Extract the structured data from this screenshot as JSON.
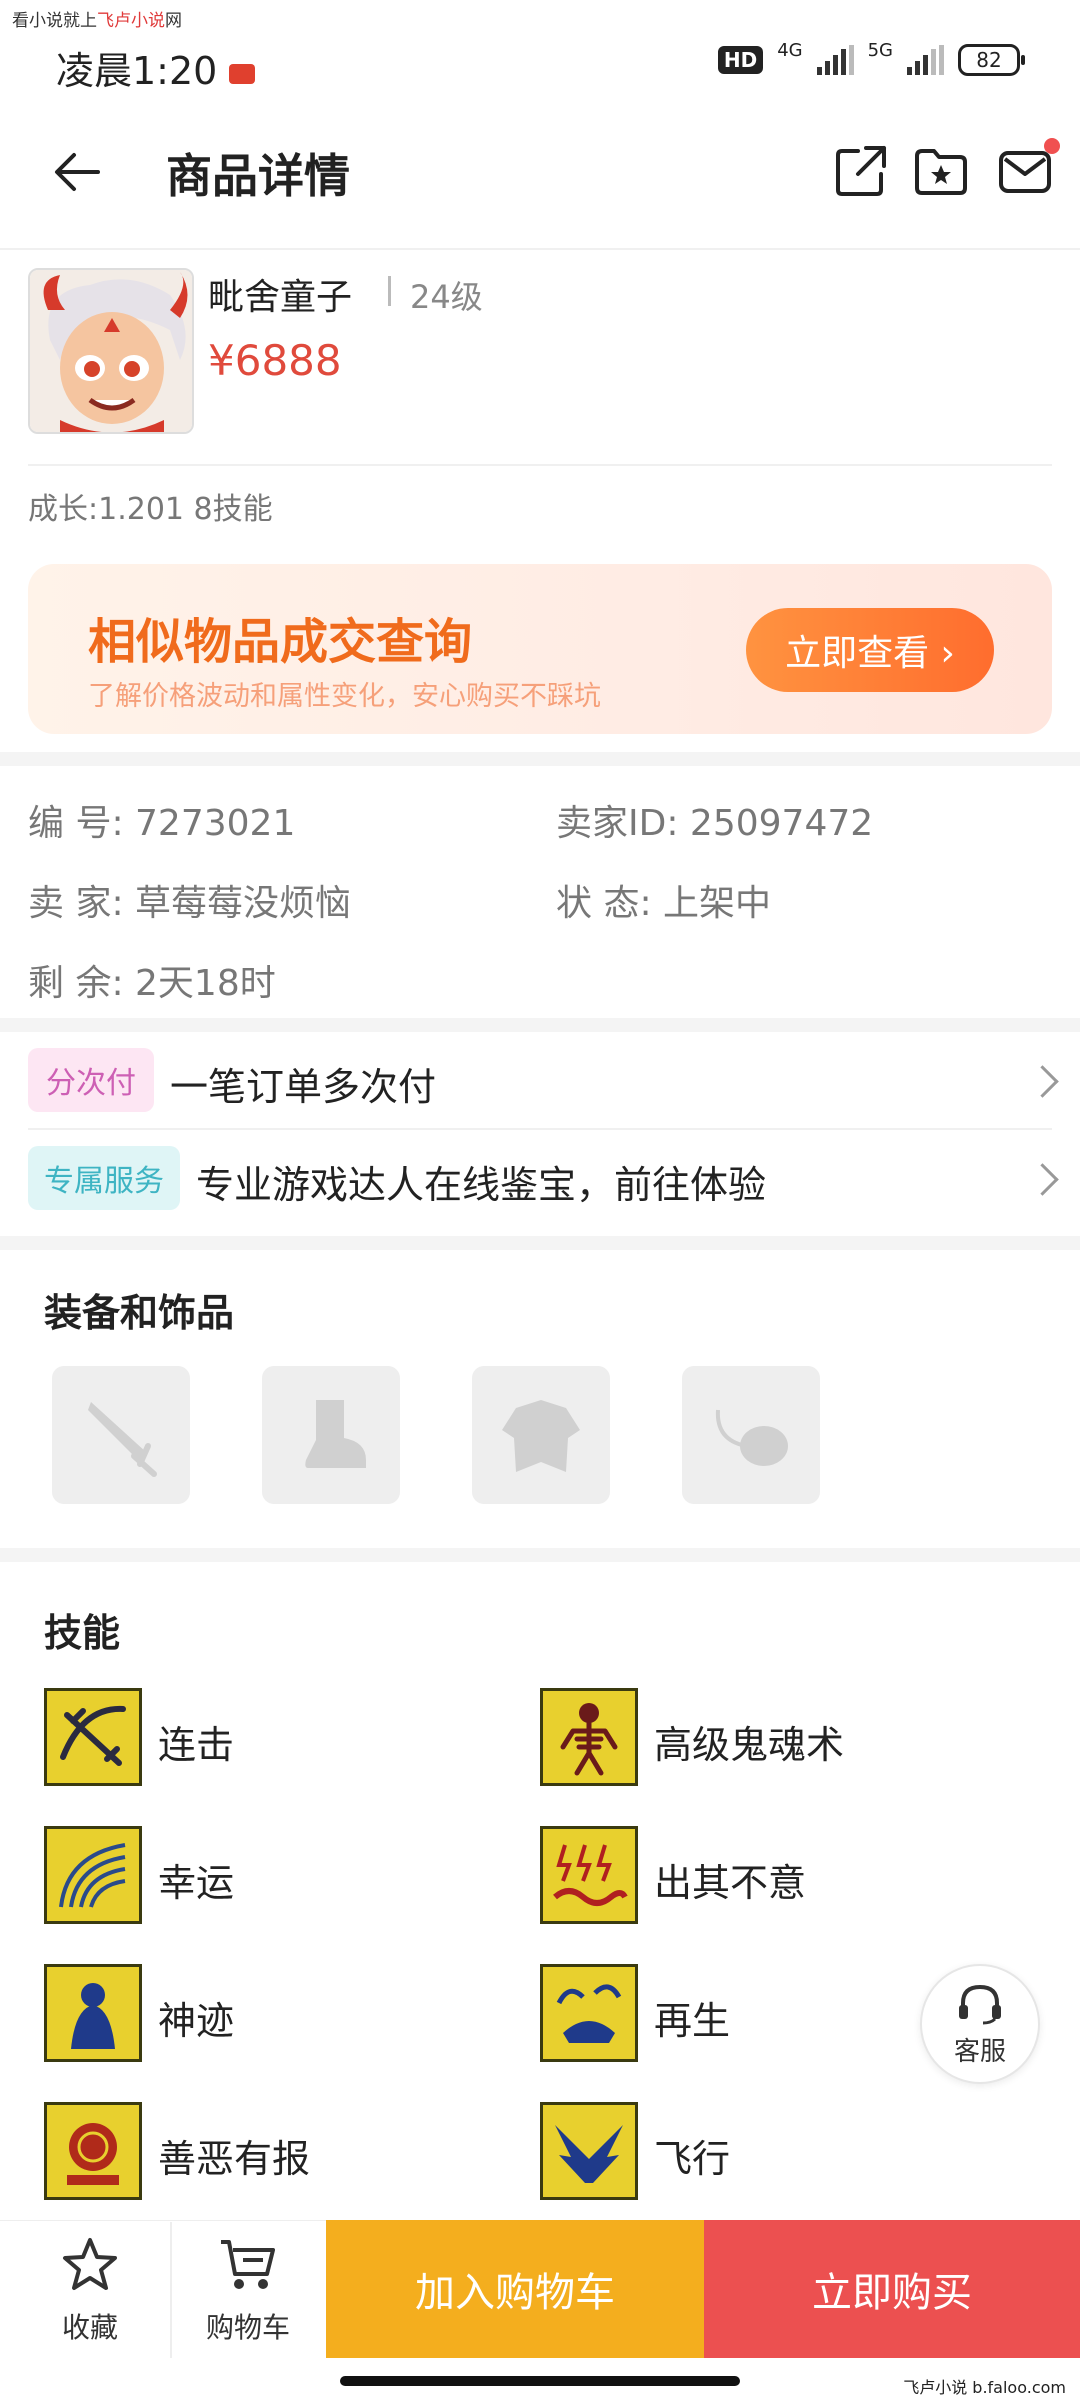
{
  "watermark": {
    "prefix": "看小说就上",
    "brand": "飞卢小说",
    "suffix": "网"
  },
  "status": {
    "time": "凌晨1:20",
    "hd": "HD",
    "net1": "4G",
    "net2": "5G",
    "battery": "82"
  },
  "header": {
    "title": "商品详情"
  },
  "product": {
    "name": "毗舍童子",
    "level": "24级",
    "price": "¥6888",
    "growth": "成长:1.201 8技能"
  },
  "banner": {
    "title": "相似物品成交查询",
    "subtitle": "了解价格波动和属性变化，安心购买不踩坑",
    "button": "立即查看 ›"
  },
  "info": {
    "id_label": "编  号:",
    "id_value": "7273021",
    "seller_id_label": "卖家ID:",
    "seller_id_value": "25097472",
    "seller_label": "卖  家:",
    "seller_value": "草莓莓没烦恼",
    "state_label": "状  态:",
    "state_value": "上架中",
    "remain_label": "剩  余:",
    "remain_value": "2天18时"
  },
  "services": [
    {
      "tag": "分次付",
      "text": "一笔订单多次付"
    },
    {
      "tag": "专属服务",
      "text": "专业游戏达人在线鉴宝，前往体验"
    }
  ],
  "equipment": {
    "title": "装备和饰品",
    "slots": [
      "weapon-icon",
      "boot-icon",
      "armor-icon",
      "necklace-icon"
    ]
  },
  "skills": {
    "title": "技能",
    "items": [
      {
        "label": "连击",
        "icon": "combo-skill-icon"
      },
      {
        "label": "高级鬼魂术",
        "icon": "ghost-skill-icon"
      },
      {
        "label": "幸运",
        "icon": "luck-skill-icon"
      },
      {
        "label": "出其不意",
        "icon": "surprise-skill-icon"
      },
      {
        "label": "神迹",
        "icon": "miracle-skill-icon"
      },
      {
        "label": "再生",
        "icon": "regen-skill-icon"
      },
      {
        "label": "善恶有报",
        "icon": "karma-skill-icon"
      },
      {
        "label": "飞行",
        "icon": "fly-skill-icon"
      }
    ]
  },
  "float": {
    "customer_service": "客服"
  },
  "bottom": {
    "favorite": "收藏",
    "cart": "购物车",
    "add_to_cart": "加入购物车",
    "buy_now": "立即购买"
  },
  "watermark_bottom": "飞卢小说  b.faloo.com",
  "colors": {
    "price": "#e04a3c",
    "banner_accent": "#f06b1c",
    "cart_button": "#f4ae1e",
    "buy_button": "#ec5050"
  }
}
